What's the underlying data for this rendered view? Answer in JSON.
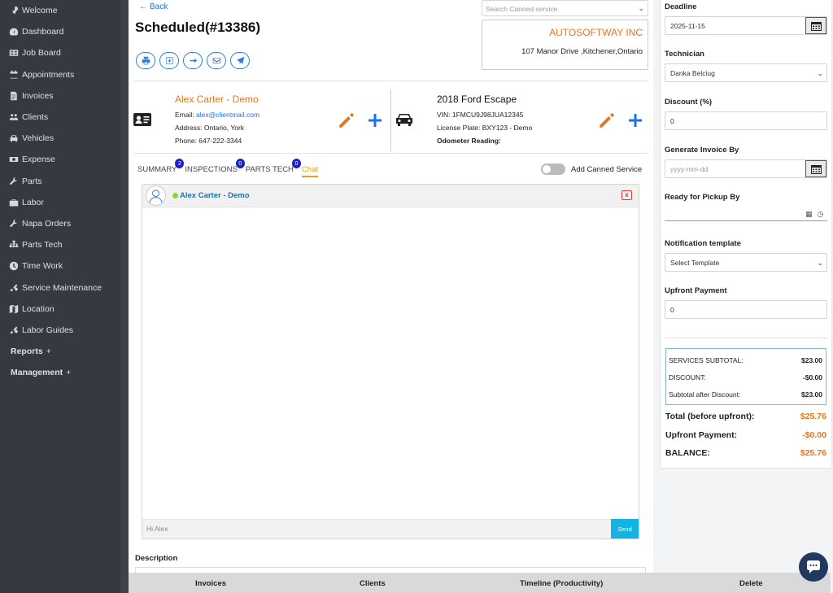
{
  "sidebar": {
    "items": [
      {
        "label": "Welcome",
        "icon": "rocket-icon"
      },
      {
        "label": "Dashboard",
        "icon": "dashboard-icon"
      },
      {
        "label": "Job Board",
        "icon": "board-icon"
      },
      {
        "label": "Appointments",
        "icon": "calendar-icon"
      },
      {
        "label": "Invoices",
        "icon": "invoice-icon"
      },
      {
        "label": "Clients",
        "icon": "users-icon"
      },
      {
        "label": "Vehicles",
        "icon": "car-icon"
      },
      {
        "label": "Expense",
        "icon": "money-icon"
      },
      {
        "label": "Parts",
        "icon": "wrench-icon"
      },
      {
        "label": "Labor",
        "icon": "briefcase-icon"
      },
      {
        "label": "Napa Orders",
        "icon": "wrench-icon"
      },
      {
        "label": "Parts Tech",
        "icon": "sitemap-icon"
      },
      {
        "label": "Time Work",
        "icon": "clock-icon"
      },
      {
        "label": "Service Maintenance",
        "icon": "tools-icon"
      },
      {
        "label": "Location",
        "icon": "map-icon"
      },
      {
        "label": "Labor Guides",
        "icon": "tools-icon"
      }
    ],
    "reports": {
      "label": "Reports",
      "plus": "+"
    },
    "management": {
      "label": "Management",
      "plus": "+"
    }
  },
  "header": {
    "back": "Back",
    "title": "Scheduled(#13386)",
    "canned_placeholder": "Search Canned service"
  },
  "company": {
    "name": "AUTOSOFTWAY INC",
    "address": "107 Manor Drive ,Kitchener,Ontario"
  },
  "client": {
    "name": "Alex Carter - Demo",
    "email_label": "Email:",
    "email": "alex@clientmail.com",
    "address": "Address: Ontario, York",
    "phone": "Phone: 647-222-3344"
  },
  "vehicle": {
    "name": "2018 Ford Escape",
    "vin": "VIN: 1FMCU9J98JUA12345",
    "plate": "License Plate: BXY123 - Demo",
    "odometer": "Odometer Reading:"
  },
  "tabs": [
    {
      "label": "SUMMARY",
      "badge": "2"
    },
    {
      "label": "INSPECTIONS",
      "badge": "0"
    },
    {
      "label": "PARTS TECH",
      "badge": "0"
    },
    {
      "label": "Chat",
      "badge": ""
    }
  ],
  "add_canned_label": "Add Canned Service",
  "chat": {
    "contact": "Alex Carter - Demo",
    "close": "x",
    "input_value": "Hi Alex",
    "send": "Send"
  },
  "description_label": "Description",
  "right": {
    "deadline_label": "Deadline",
    "deadline_value": "2025-11-15",
    "technician_label": "Technician",
    "technician_value": "Danka Belciug",
    "discount_label": "Discount (%)",
    "discount_value": "0",
    "generate_label": "Generate Invoice By",
    "generate_placeholder": "yyyy-mm-dd",
    "pickup_label": "Ready for Pickup By",
    "notification_label": "Notification template",
    "notification_value": "Select Template",
    "upfront_label": "Upfront Payment",
    "upfront_value": "0"
  },
  "totals": {
    "services_subtotal_label": "SERVICES SUBTOTAL:",
    "services_subtotal": "$23.00",
    "discount_label": "DISCOUNT:",
    "discount": "-$0.00",
    "after_discount_label": "Subtotal after Discount:",
    "after_discount": "$23.00",
    "total_label": "Total (before upfront):",
    "total": "$25.76",
    "upfront_label": "Upfront Payment:",
    "upfront": "-$0.00",
    "balance_label": "BALANCE:",
    "balance": "$25.76"
  },
  "footer": {
    "invoices": "Invoices",
    "clients": "Clients",
    "timeline": "Timeline (Productivity)",
    "delete": "Delete"
  },
  "colors": {
    "sidebar": "#343a40",
    "accent_orange": "#e8741c",
    "accent_blue": "#2f7ed8",
    "tab_active": "#e8a020",
    "send": "#14b3e6"
  }
}
